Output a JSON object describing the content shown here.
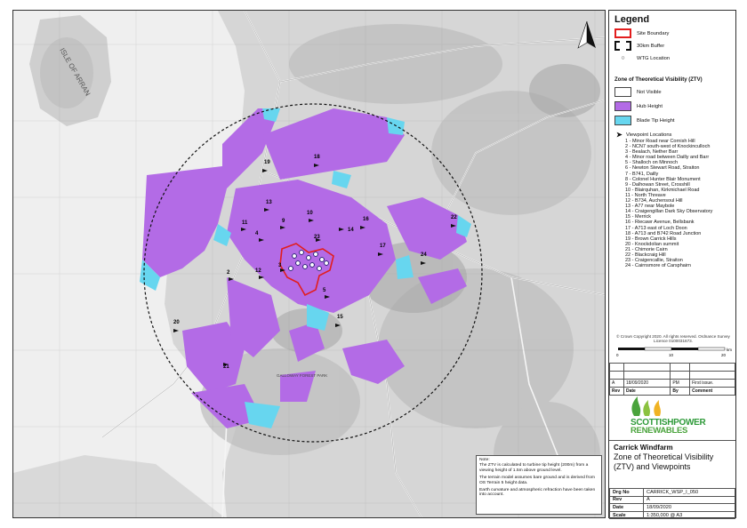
{
  "legend": {
    "title": "Legend",
    "site_boundary": "Site Boundary",
    "buffer": "30km Buffer",
    "wtg": "WTG Location",
    "ztv_heading": "Zone of Theoretical Visibility (ZTV)",
    "not_visible": "Not Visible",
    "hub_height": "Hub Height",
    "blade_tip": "Blade Tip Height",
    "viewpoint_heading": "Viewpoint Locations",
    "colors": {
      "hub": "#b36be6",
      "blade": "#67d6ef",
      "site": "#e21d1d"
    }
  },
  "viewpoints": [
    "1 - Minor Road near Cornish Hill",
    "2 - NCN7 south-west of Knockinculloch",
    "3 - Bealach, Nether Barr",
    "4 - Minor road between Dailly and Barr",
    "5 - Shalloch on Minnoch",
    "6 - Newton Stewart Road, Straiton",
    "7 - B741, Dailly",
    "8 - Colonel Hunter Blair Monument",
    "9 - Dalhowan Street, Crosshill",
    "10 - Blairquhan, Kirkmichael Road",
    "11 - North Threave",
    "12 - B734, Auchensoul Hill",
    "13 - A77 near Maybole",
    "14 - Craigengillan Dark Sky Observatory",
    "15 - Merrick",
    "16 - Riecawr Avenue, Bellsbank",
    "17 - A713 east of Loch Doon",
    "18 - A713 and B742 Road Junction",
    "19 - Brown Carrick Hills",
    "20 - Knockdolian summit",
    "21 - Chimorie Cairn",
    "22 - Blackcraig Hill",
    "23 - Craigencallie, Straiton",
    "24 - Cairnsmore of Carsphairn"
  ],
  "map": {
    "vp_numbers": [
      "19",
      "18",
      "13",
      "11",
      "9",
      "10",
      "14",
      "16",
      "22",
      "17",
      "23",
      "24",
      "12",
      "3",
      "4",
      "2",
      "5",
      "15",
      "20",
      "21"
    ],
    "place_labels": [
      "ISLE OF ARRAN",
      "GALLOWAY FOREST PARK"
    ]
  },
  "copyright": "© Crown Copyright 2020. All rights reserved. Ordnance Survey Licence 0100031673.",
  "scalebar": {
    "labels": [
      "0",
      "10",
      "20"
    ],
    "unit": "km"
  },
  "revision": {
    "row": {
      "rev": "A",
      "date": "18/09/2020",
      "by": "PM",
      "comment": "First issue."
    },
    "headers": {
      "rev": "Rev",
      "date": "Date",
      "by": "By",
      "comment": "Comment"
    }
  },
  "logo": {
    "line1": "SCOTTISHPOWER",
    "line2": "RENEWABLES"
  },
  "title_block": {
    "project": "Carrick Windfarm",
    "title": "Zone of Theoretical Visibility (ZTV) and Viewpoints"
  },
  "info": {
    "drg_label": "Drg No",
    "drg": "CARRICK_WSP_I_050",
    "rev_label": "Rev",
    "rev": "A",
    "date_label": "Date",
    "date": "18/09/2020",
    "scale_label": "Scale",
    "scale": "1:350,000 @ A3"
  },
  "note": {
    "label": "Note:",
    "p1": "The ZTV is calculated to turbine tip height (200m) from a viewing height of 1.5m above ground level.",
    "p2": "The terrain model assumes bare ground and is derived from OS Terrain 5 height data.",
    "p3": "Earth curvature and atmospheric refraction have been taken into account."
  }
}
